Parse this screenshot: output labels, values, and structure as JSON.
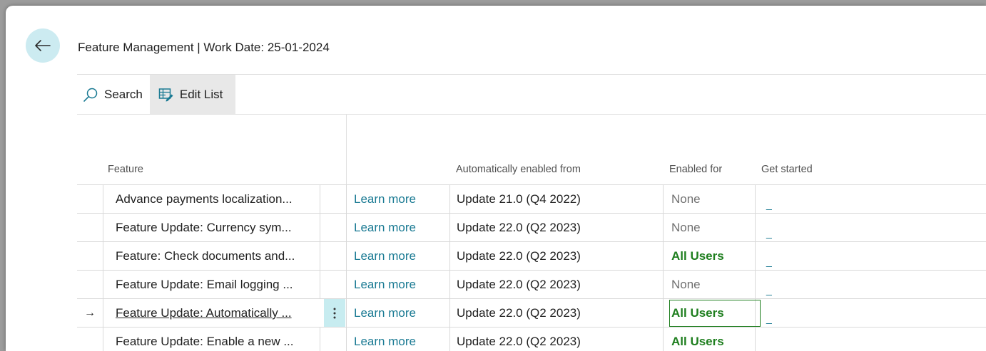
{
  "header": {
    "title": "Feature Management | Work Date: 25-01-2024",
    "back_icon": "arrow-left-icon"
  },
  "toolbar": {
    "search_label": "Search",
    "search_icon": "search-icon",
    "edit_list_label": "Edit List",
    "edit_list_icon": "edit-list-icon"
  },
  "columns": {
    "feature": "Feature",
    "auto_enabled": "Automatically enabled from",
    "enabled_for": "Enabled for",
    "get_started": "Get started"
  },
  "rows": [
    {
      "feature": "Advance payments localization...",
      "learn_more": "Learn more",
      "auto_enabled": "Update 21.0 (Q4 2022)",
      "enabled_for": "None",
      "get_started": "_"
    },
    {
      "feature": "Feature Update: Currency sym...",
      "learn_more": "Learn more",
      "auto_enabled": "Update 22.0 (Q2 2023)",
      "enabled_for": "None",
      "get_started": "_"
    },
    {
      "feature": "Feature: Check documents and...",
      "learn_more": "Learn more",
      "auto_enabled": "Update 22.0 (Q2 2023)",
      "enabled_for": "All Users",
      "get_started": "_"
    },
    {
      "feature": "Feature Update: Email logging ...",
      "learn_more": "Learn more",
      "auto_enabled": "Update 22.0 (Q2 2023)",
      "enabled_for": "None",
      "get_started": "_"
    },
    {
      "feature": "Feature Update: Automatically ...",
      "learn_more": "Learn more",
      "auto_enabled": "Update 22.0 (Q2 2023)",
      "enabled_for": "All Users",
      "get_started": "_",
      "selected": true,
      "arrow": "→"
    },
    {
      "feature": "Feature Update: Enable a new ...",
      "learn_more": "Learn more",
      "auto_enabled": "Update 22.0 (Q2 2023)",
      "enabled_for": "All Users",
      "get_started": "_"
    }
  ],
  "colors": {
    "accent": "#1a7a93",
    "enabled_green": "#1e7e1e",
    "back_button_bg": "#ccebf1"
  }
}
